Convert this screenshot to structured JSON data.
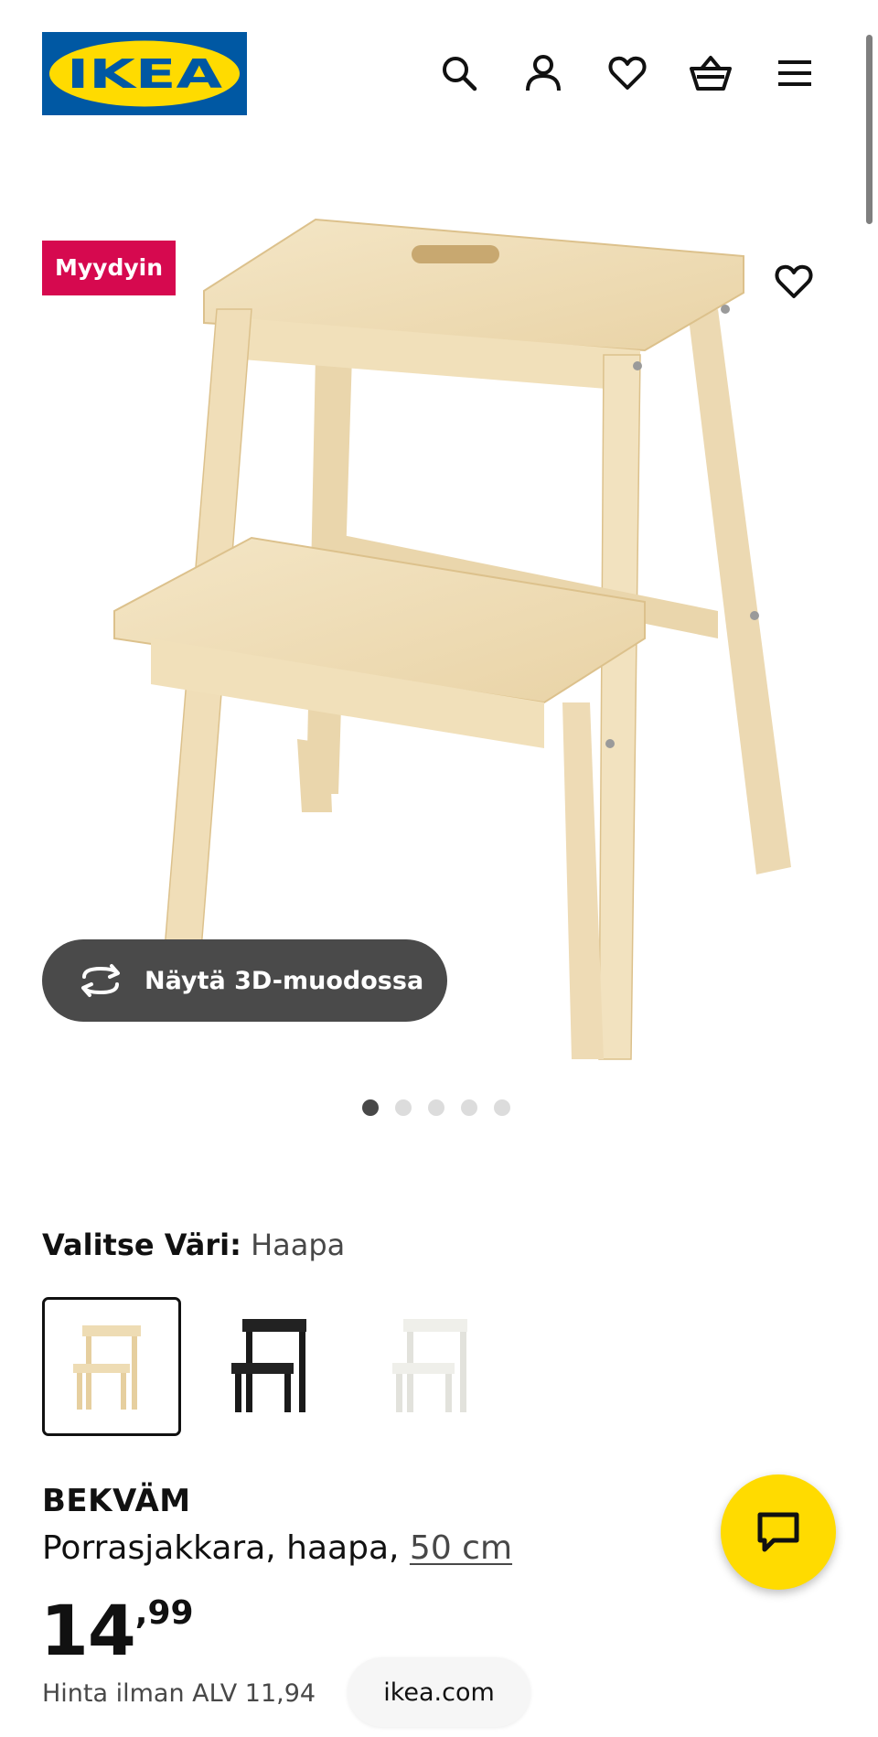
{
  "header": {
    "logo_text": "IKEA",
    "icons": [
      "search-icon",
      "user-icon",
      "heart-icon",
      "basket-icon",
      "menu-icon"
    ]
  },
  "gallery": {
    "badge": "Myydyin",
    "view_3d_label": "Näytä 3D-muodossa",
    "dot_count": 5,
    "active_dot": 0
  },
  "color_selector": {
    "label": "Valitse Väri:",
    "selected": "Haapa",
    "swatches": [
      "Haapa",
      "musta",
      "valkoinen"
    ]
  },
  "product": {
    "name": "BEKVÄM",
    "description": "Porrasjakkara, haapa,",
    "size_link": "50 cm",
    "price_integer": "14",
    "price_decimal": ",99",
    "vat_text": "Hinta ilman ALV 11,94"
  },
  "browser": {
    "url": "ikea.com"
  },
  "colors": {
    "brand_blue": "#0058a3",
    "brand_yellow": "#ffdb00",
    "badge_red": "#d6094f",
    "wood": "#efdcb4"
  }
}
